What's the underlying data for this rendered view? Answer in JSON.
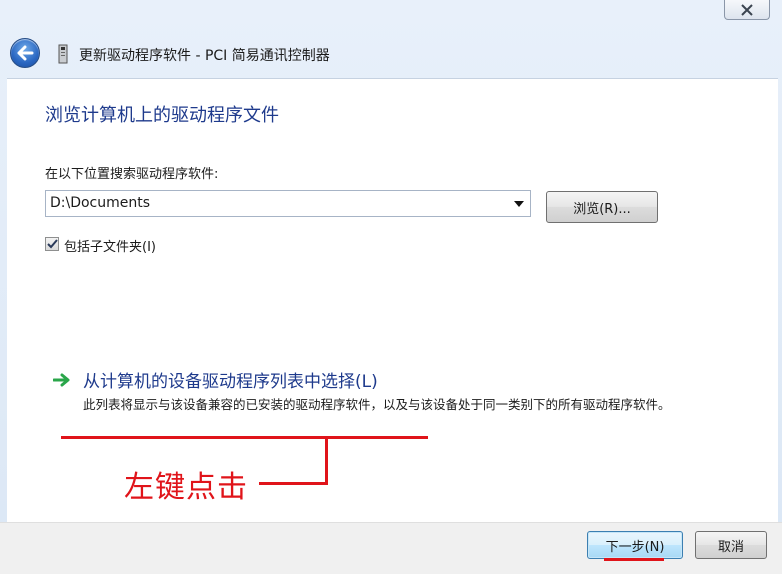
{
  "window": {
    "title": "更新驱动程序软件 - PCI 简易通讯控制器",
    "close_icon": "close-icon",
    "back_icon": "back-arrow-icon"
  },
  "main": {
    "heading": "浏览计算机上的驱动程序文件",
    "search_label": "在以下位置搜索驱动程序软件:",
    "path_value": "D:\\Documents",
    "browse_label": "浏览(R)...",
    "include_subfolders_label": "包括子文件夹(I)",
    "include_subfolders_checked": true
  },
  "pick_option": {
    "title": "从计算机的设备驱动程序列表中选择(L)",
    "description": "此列表将显示与该设备兼容的已安装的驱动程序软件，以及与该设备处于同一类别下的所有驱动程序软件。"
  },
  "annotation": {
    "text": "左键点击",
    "color": "#e0141a"
  },
  "footer": {
    "next_label": "下一步(N)",
    "cancel_label": "取消"
  },
  "colors": {
    "heading": "#1e3a8c",
    "link_arrow": "#2aa64a",
    "accent_button_border": "#3c7fb1"
  }
}
